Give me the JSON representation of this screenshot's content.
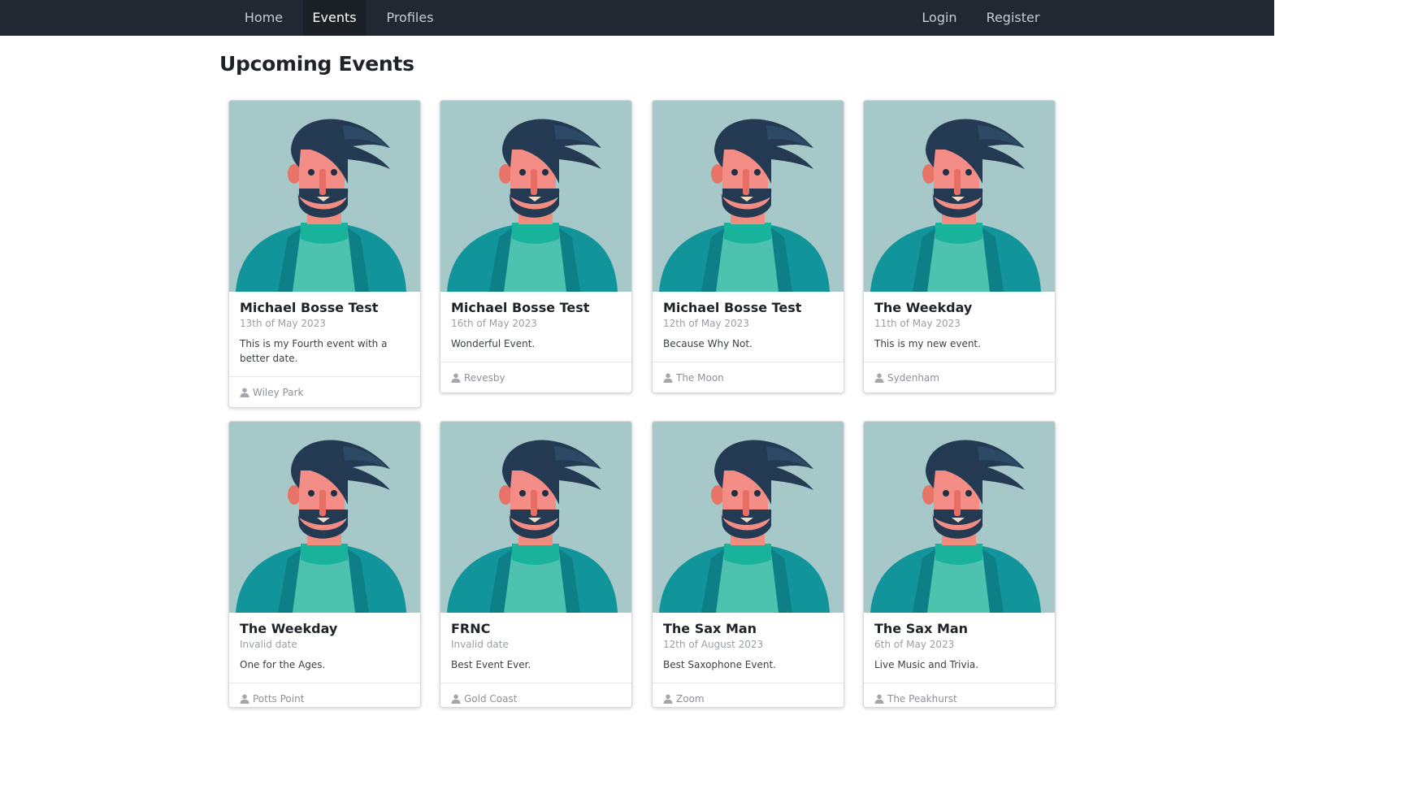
{
  "nav": {
    "home": "Home",
    "events": "Events",
    "profiles": "Profiles",
    "login": "Login",
    "register": "Register"
  },
  "page": {
    "title": "Upcoming Events"
  },
  "events": [
    {
      "title": "Michael Bosse Test",
      "date": "13th of May 2023",
      "description": "This is my Fourth event with a better date.",
      "location": "Wiley Park"
    },
    {
      "title": "Michael Bosse Test",
      "date": "16th of May 2023",
      "description": "Wonderful Event.",
      "location": "Revesby"
    },
    {
      "title": "Michael Bosse Test",
      "date": "12th of May 2023",
      "description": "Because Why Not.",
      "location": "The Moon"
    },
    {
      "title": "The Weekday",
      "date": "11th of May 2023",
      "description": "This is my new event.",
      "location": "Sydenham"
    },
    {
      "title": "The Weekday",
      "date": "Invalid date",
      "description": "One for the Ages.",
      "location": "Potts Point"
    },
    {
      "title": "FRNC",
      "date": "Invalid date",
      "description": "Best Event Ever.",
      "location": "Gold Coast"
    },
    {
      "title": "The Sax Man",
      "date": "12th of August 2023",
      "description": "Best Saxophone Event.",
      "location": "Zoom"
    },
    {
      "title": "The Sax Man",
      "date": "6th of May 2023",
      "description": "Live Music and Trivia.",
      "location": "The Peakhurst"
    }
  ],
  "icons": {
    "location": "user-icon",
    "avatar": "bearded-man-avatar"
  },
  "colors": {
    "navbar": "#222831",
    "avatar_bg": "#a7c8c8"
  }
}
